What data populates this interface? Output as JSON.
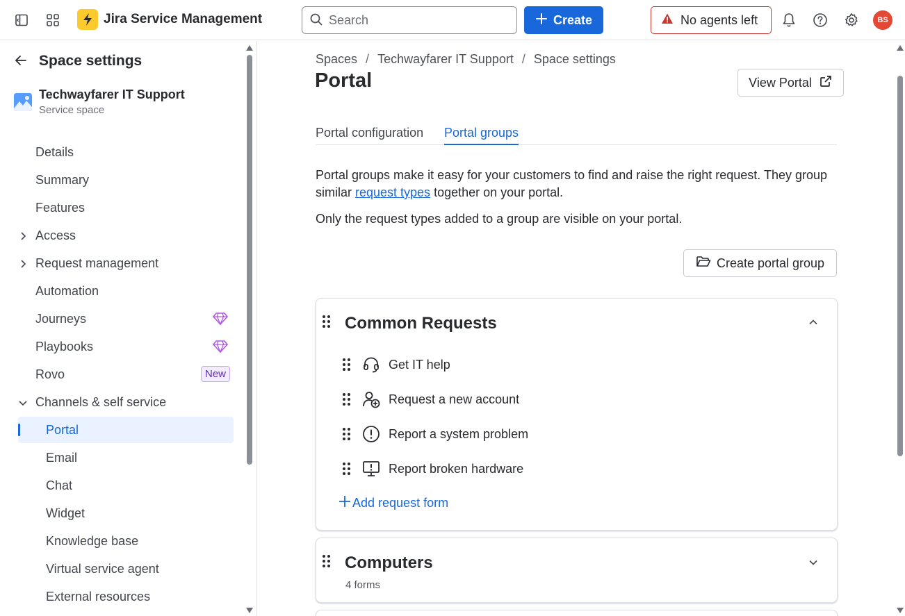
{
  "topbar": {
    "app_name": "Jira Service Management",
    "search_placeholder": "Search",
    "create_label": "Create",
    "agents_warning": "No agents left",
    "avatar_initials": "BS",
    "brand_color": "#1868db",
    "icons": [
      "sidebar-toggle-icon",
      "app-switcher-icon",
      "jsm-logo-icon",
      "search-icon",
      "plus-icon",
      "warning-icon",
      "bell-icon",
      "help-icon",
      "gear-icon"
    ]
  },
  "sidebar": {
    "title": "Space settings",
    "space_name": "Techwayfarer IT Support",
    "space_type": "Service space",
    "items": [
      {
        "label": "Details"
      },
      {
        "label": "Summary"
      },
      {
        "label": "Features"
      },
      {
        "label": "Access",
        "expandable": true
      },
      {
        "label": "Request management",
        "expandable": true
      },
      {
        "label": "Automation"
      },
      {
        "label": "Journeys",
        "badge": "gem-icon"
      },
      {
        "label": "Playbooks",
        "badge": "gem-icon"
      },
      {
        "label": "Rovo",
        "badge_text": "New"
      },
      {
        "label": "Channels & self service",
        "expanded": true
      },
      {
        "label": "Portal",
        "active": true
      },
      {
        "label": "Email"
      },
      {
        "label": "Chat"
      },
      {
        "label": "Widget"
      },
      {
        "label": "Knowledge base"
      },
      {
        "label": "Virtual service agent"
      },
      {
        "label": "External resources"
      }
    ]
  },
  "main": {
    "breadcrumbs": [
      "Spaces",
      "Techwayfarer IT Support",
      "Space settings"
    ],
    "breadcrumb_sep": "/",
    "title": "Portal",
    "view_portal_label": "View Portal",
    "tabs": [
      {
        "label": "Portal configuration",
        "active": false
      },
      {
        "label": "Portal groups",
        "active": true
      }
    ],
    "description_before_link": "Portal groups make it easy for your customers to find and raise the right request. They group similar ",
    "description_link": "request types",
    "description_after_link": " together on your portal.",
    "description_2": "Only the request types added to a group are visible on your portal.",
    "create_group_label": "Create portal group",
    "groups": [
      {
        "title": "Common Requests",
        "expanded": true,
        "requests": [
          {
            "label": "Get IT help",
            "icon": "headset-icon"
          },
          {
            "label": "Request a new account",
            "icon": "add-user-icon"
          },
          {
            "label": "Report a system problem",
            "icon": "alert-circle-icon"
          },
          {
            "label": "Report broken hardware",
            "icon": "monitor-alert-icon"
          }
        ],
        "add_form_label": "Add request form"
      },
      {
        "title": "Computers",
        "expanded": false,
        "forms_count": "4 forms"
      }
    ]
  }
}
